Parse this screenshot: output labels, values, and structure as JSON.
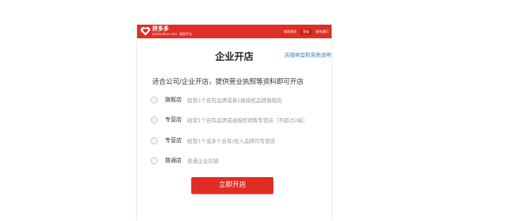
{
  "header": {
    "brand_name": "拼多多",
    "brand_sub": "pinduoduo.com",
    "brand_tag": "商家平台",
    "links": [
      "商家登录",
      "登录"
    ],
    "right_link": "联系我们"
  },
  "title": "企业开店",
  "help_link": "店铺类型和资质说明",
  "intro": "适合公司/企业开店，提供营业执照等资料即可开店",
  "options": [
    {
      "name": "旗舰店",
      "desc": "经营1个自有品牌或者1级授权品牌旗舰店"
    },
    {
      "name": "专营店",
      "desc": "经营1个自有品牌或者授权销售专营店（不超过2级）"
    },
    {
      "name": "专营店",
      "desc": "经营1个或多个自有/他人品牌的专营店"
    },
    {
      "name": "普通店",
      "desc": "普通企业店铺"
    }
  ],
  "submit_label": "立即开店",
  "colors": {
    "brand_red": "#e02e24",
    "link_blue": "#3a7ab8"
  }
}
